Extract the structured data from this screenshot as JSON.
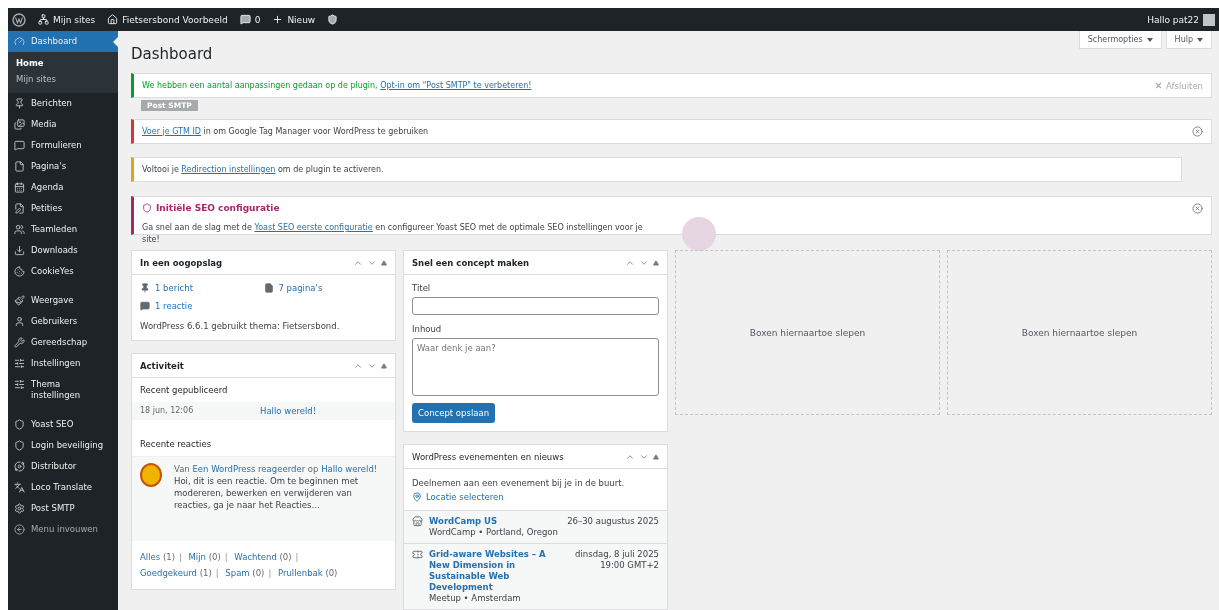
{
  "admin_bar": {
    "items": [
      {
        "kind": "wp"
      },
      {
        "kind": "sites",
        "label": "Mijn sites"
      },
      {
        "kind": "home",
        "label": "Fietsersbond Voorbeeld"
      },
      {
        "kind": "comments",
        "label": "0"
      },
      {
        "kind": "new",
        "label": "Nieuw"
      },
      {
        "kind": "yoast"
      }
    ],
    "greeting": "Hallo pat22"
  },
  "sidebar": {
    "groups": [
      [
        {
          "kind": "dashboard",
          "label": "Dashboard",
          "selected": true,
          "children": [
            {
              "label": "Home",
              "selected": true
            },
            {
              "label": "Mijn sites",
              "selected": false
            }
          ]
        },
        {
          "kind": "pin",
          "label": "Berichten",
          "selected": false
        },
        {
          "kind": "media",
          "label": "Media",
          "selected": false
        },
        {
          "kind": "forms",
          "label": "Formulieren",
          "selected": false
        },
        {
          "kind": "pages",
          "label": "Pagina's",
          "selected": false
        },
        {
          "kind": "calendar",
          "label": "Agenda",
          "selected": false
        },
        {
          "kind": "petition",
          "label": "Petities",
          "selected": false
        },
        {
          "kind": "team",
          "label": "Teamleden",
          "selected": false
        },
        {
          "kind": "download",
          "label": "Downloads",
          "selected": false
        },
        {
          "kind": "cookie",
          "label": "CookieYes",
          "selected": false
        }
      ],
      [
        {
          "kind": "brush",
          "label": "Weergave",
          "selected": false
        },
        {
          "kind": "user",
          "label": "Gebruikers",
          "selected": false
        },
        {
          "kind": "wrench",
          "label": "Gereedschap",
          "selected": false
        },
        {
          "kind": "settings",
          "label": "Instellingen",
          "selected": false
        },
        {
          "kind": "settings",
          "label": "Thema instellingen",
          "selected": false
        }
      ],
      [
        {
          "kind": "yoast",
          "label": "Yoast SEO",
          "selected": false
        },
        {
          "kind": "shield",
          "label": "Login beveiliging",
          "selected": false
        },
        {
          "kind": "distributor",
          "label": "Distributor",
          "selected": false
        },
        {
          "kind": "translate",
          "label": "Loco Translate",
          "selected": false
        },
        {
          "kind": "gear",
          "label": "Post SMTP",
          "selected": false
        },
        {
          "kind": "collapse",
          "label": "Menu invouwen",
          "selected": false,
          "muted": true
        }
      ]
    ]
  },
  "page": {
    "title": "Dashboard",
    "buttons": [
      "Schermopties",
      "Hulp"
    ]
  },
  "notices": [
    {
      "kind": "success",
      "parts": [
        {
          "text": "We hebben een aantal aanpassingen gedaan op de plugin, ",
          "link": false
        },
        {
          "text": "Opt-in om \"Post SMTP\" te verbeteren!",
          "link": true
        }
      ],
      "dismiss": "Afsluiten",
      "tag": "Post SMTP",
      "dismissible": false
    },
    {
      "kind": "error",
      "parts": [
        {
          "text": "Voer je GTM ID",
          "link": true
        },
        {
          "text": " in om Google Tag Manager voor WordPress te gebruiken",
          "link": false
        }
      ],
      "dismissible": true
    },
    {
      "kind": "warning",
      "parts": [
        {
          "text": "Voltooi je ",
          "link": false
        },
        {
          "text": "Redirection instellingen",
          "link": true
        },
        {
          "text": " om de plugin te activeren.",
          "link": false
        }
      ],
      "dismissible": false
    },
    {
      "kind": "yoast",
      "title": "Initiële SEO configuratie",
      "parts": [
        {
          "text": "Ga snel aan de slag met de ",
          "link": false
        },
        {
          "text": "Yoast SEO eerste configuratie",
          "link": true
        },
        {
          "text": " en configureer Yoast SEO met de optimale SEO instellingen voor je site!",
          "link": false
        }
      ],
      "dismissible": true
    }
  ],
  "glance": {
    "title": "In een oogopslag",
    "items": [
      {
        "kind": "pin",
        "label": "1 bericht"
      },
      {
        "kind": "pages",
        "label": "7 pagina's"
      },
      {
        "kind": "comment",
        "label": "1 reactie"
      }
    ],
    "footer": "WordPress 6.6.1 gebruikt thema: Fietsersbond."
  },
  "activity": {
    "title": "Activiteit",
    "published_heading": "Recent gepubliceerd",
    "published": [
      {
        "date": "18 jun, 12:06",
        "title": "Hallo wereld!"
      }
    ],
    "comments_heading": "Recente reacties",
    "comments": [
      {
        "from": "Van ",
        "author": "Een WordPress reageerder",
        "on": " op ",
        "post": "Hallo wereld!",
        "excerpt": "Hoi, dit is een reactie. Om te beginnen met modereren, bewerken en verwijderen van reacties, ga je naar het Reacties…"
      }
    ],
    "filter_separator": "|",
    "filters": [
      {
        "label": "Alles",
        "count": "(1)"
      },
      {
        "label": "Mijn",
        "count": "(0)"
      },
      {
        "label": "Wachtend",
        "count": "(0)"
      },
      {
        "label": "Goedgekeurd",
        "count": "(1)"
      },
      {
        "label": "Spam",
        "count": "(0)"
      },
      {
        "label": "Prullenbak",
        "count": "(0)"
      }
    ]
  },
  "draft": {
    "title": "Snel een concept maken",
    "title_label": "Titel",
    "content_label": "Inhoud",
    "content_placeholder": "Waar denk je aan?",
    "button": "Concept opslaan"
  },
  "events": {
    "title": "WordPress evenementen en nieuws",
    "intro": "Deelnemen aan een evenement bij je in de buurt.",
    "location_link": "Locatie selecteren",
    "items": [
      {
        "kind": "wordcamp",
        "title": "WordCamp US",
        "meta": "WordCamp • Portland, Oregon",
        "date": "26–30 augustus 2025"
      },
      {
        "kind": "meetup",
        "title": "Grid-aware Websites – A New Dimension in Sustainable Web Development",
        "meta": "Meetup • Amsterdam",
        "date": "dinsdag, 8 juli 2025",
        "time": "19:00 GMT+2"
      }
    ]
  },
  "dropzones": [
    "Boxen hiernaartoe slepen",
    "Boxen hiernaartoe slepen"
  ]
}
